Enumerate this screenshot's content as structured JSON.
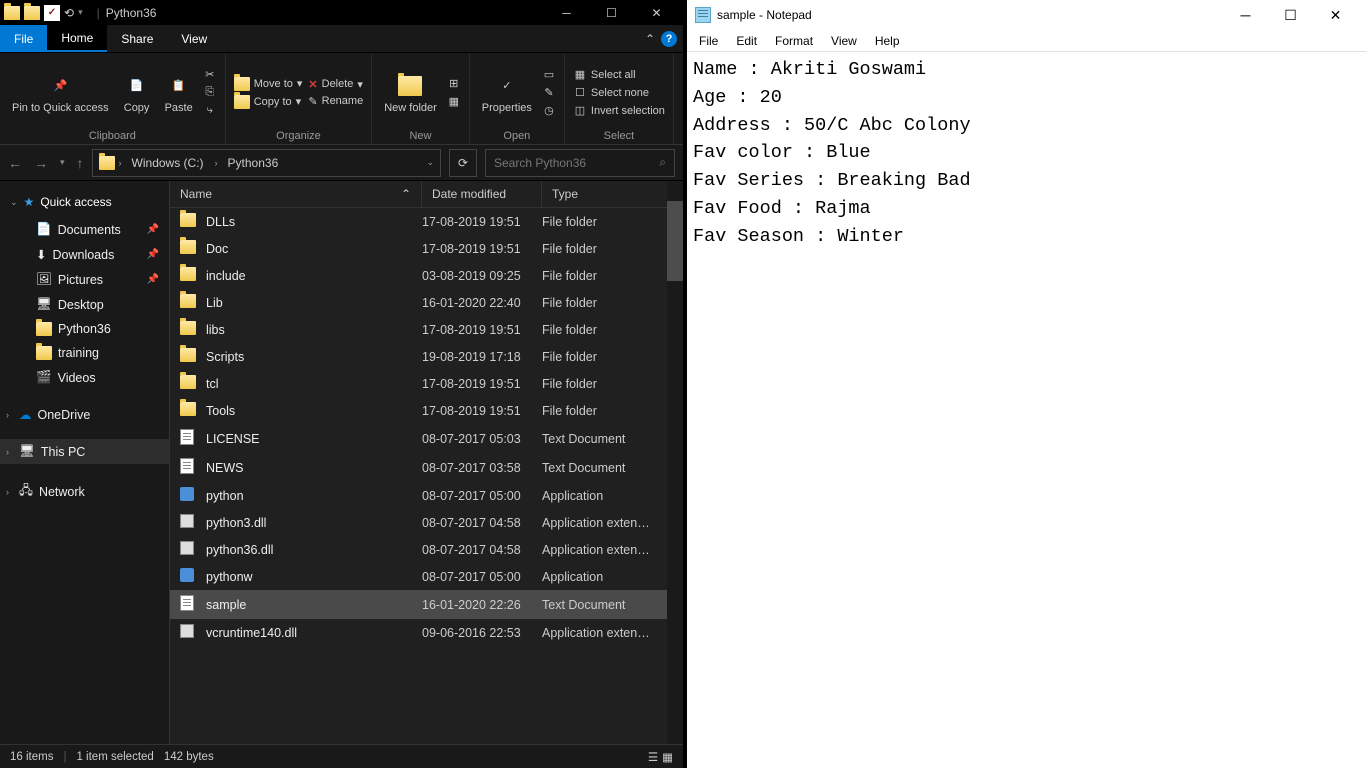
{
  "explorer": {
    "title": "Python36",
    "tabs": {
      "file": "File",
      "home": "Home",
      "share": "Share",
      "view": "View"
    },
    "ribbon": {
      "clipboard": {
        "label": "Clipboard",
        "pin": "Pin to Quick access",
        "copy": "Copy",
        "paste": "Paste"
      },
      "organize": {
        "label": "Organize",
        "moveto": "Move to",
        "copyto": "Copy to",
        "delete": "Delete",
        "rename": "Rename"
      },
      "new": {
        "label": "New",
        "folder": "New folder"
      },
      "open": {
        "label": "Open",
        "properties": "Properties"
      },
      "select": {
        "label": "Select",
        "all": "Select all",
        "none": "Select none",
        "invert": "Invert selection"
      }
    },
    "breadcrumb": {
      "drive": "Windows (C:)",
      "folder": "Python36"
    },
    "search_placeholder": "Search Python36",
    "sidebar": {
      "quick": "Quick access",
      "items": [
        {
          "label": "Documents"
        },
        {
          "label": "Downloads"
        },
        {
          "label": "Pictures"
        },
        {
          "label": "Desktop"
        },
        {
          "label": "Python36"
        },
        {
          "label": "training"
        },
        {
          "label": "Videos"
        }
      ],
      "onedrive": "OneDrive",
      "thispc": "This PC",
      "network": "Network"
    },
    "columns": {
      "name": "Name",
      "date": "Date modified",
      "type": "Type"
    },
    "files": [
      {
        "name": "DLLs",
        "date": "17-08-2019 19:51",
        "type": "File folder",
        "icon": "folder"
      },
      {
        "name": "Doc",
        "date": "17-08-2019 19:51",
        "type": "File folder",
        "icon": "folder"
      },
      {
        "name": "include",
        "date": "03-08-2019 09:25",
        "type": "File folder",
        "icon": "folder"
      },
      {
        "name": "Lib",
        "date": "16-01-2020 22:40",
        "type": "File folder",
        "icon": "folder"
      },
      {
        "name": "libs",
        "date": "17-08-2019 19:51",
        "type": "File folder",
        "icon": "folder"
      },
      {
        "name": "Scripts",
        "date": "19-08-2019 17:18",
        "type": "File folder",
        "icon": "folder"
      },
      {
        "name": "tcl",
        "date": "17-08-2019 19:51",
        "type": "File folder",
        "icon": "folder"
      },
      {
        "name": "Tools",
        "date": "17-08-2019 19:51",
        "type": "File folder",
        "icon": "folder"
      },
      {
        "name": "LICENSE",
        "date": "08-07-2017 05:03",
        "type": "Text Document",
        "icon": "txt"
      },
      {
        "name": "NEWS",
        "date": "08-07-2017 03:58",
        "type": "Text Document",
        "icon": "txt"
      },
      {
        "name": "python",
        "date": "08-07-2017 05:00",
        "type": "Application",
        "icon": "app"
      },
      {
        "name": "python3.dll",
        "date": "08-07-2017 04:58",
        "type": "Application exten…",
        "icon": "dll"
      },
      {
        "name": "python36.dll",
        "date": "08-07-2017 04:58",
        "type": "Application exten…",
        "icon": "dll"
      },
      {
        "name": "pythonw",
        "date": "08-07-2017 05:00",
        "type": "Application",
        "icon": "app"
      },
      {
        "name": "sample",
        "date": "16-01-2020 22:26",
        "type": "Text Document",
        "icon": "txt",
        "selected": true
      },
      {
        "name": "vcruntime140.dll",
        "date": "09-06-2016 22:53",
        "type": "Application exten…",
        "icon": "dll"
      }
    ],
    "status": {
      "count": "16 items",
      "sel": "1 item selected",
      "size": "142 bytes"
    }
  },
  "notepad": {
    "title": "sample - Notepad",
    "menu": {
      "file": "File",
      "edit": "Edit",
      "format": "Format",
      "view": "View",
      "help": "Help"
    },
    "content": "Name : Akriti Goswami\nAge : 20\nAddress : 50/C Abc Colony\nFav color : Blue\nFav Series : Breaking Bad\nFav Food : Rajma\nFav Season : Winter"
  }
}
